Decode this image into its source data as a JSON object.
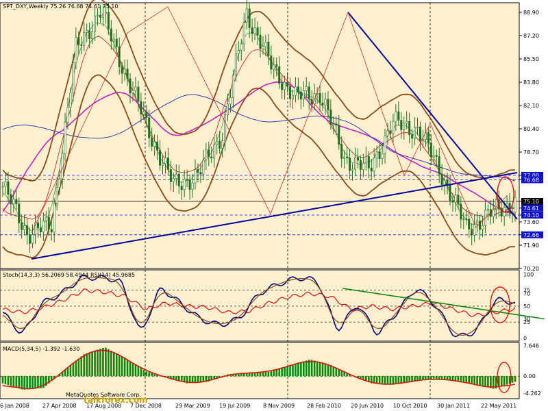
{
  "colors": {
    "background": "#fff0cf",
    "price_line": "#1f6e1f",
    "trend_line": "#0000a0",
    "ma_brown": "#8b4a12",
    "ma_magenta": "#c81ec8",
    "ma_blue": "#2e3ab0",
    "red": "#e01010",
    "green_hist": "#008a00",
    "circle": "#ff0000"
  },
  "main": {
    "header": "SPT_DXY,Weekly  75.26 76.68 74.61 75.10",
    "axis_labels": [
      "88.90",
      "87.20",
      "85.50",
      "83.80",
      "82.10",
      "80.40",
      "78.70",
      "77.00",
      "76.68",
      "75.10",
      "74.61",
      "74.10",
      "73.60",
      "72.66",
      "71.90",
      "70.20"
    ],
    "highlight_labels": [
      "77.00",
      "76.68",
      "75.10",
      "74.61",
      "74.10",
      "72.66"
    ]
  },
  "stoch": {
    "header": "Stoch(14,3,3) 56.2069 58.4944 RSI(14) 45.9685",
    "axis_labels": [
      "100",
      "75",
      "70",
      "50",
      "30",
      "25",
      "0"
    ]
  },
  "macd": {
    "header": "MACD(5,34,5) -1.392 -1.630",
    "axis_labels": [
      "7.646",
      "0.00",
      "-4.262"
    ],
    "watermark": "MetaQuotes Software Corp.",
    "brand": "talkforex.com"
  },
  "x_labels": [
    "6 Jan 2008",
    "27 Apr 2008",
    "17 Aug 2008",
    "7 Dec 2008",
    "29 Mar 2009",
    "19 Jul 2009",
    "8 Nov 2009",
    "28 Feb 2010",
    "20 Jun 2010",
    "10 Oct 2010",
    "30 Jan 2011",
    "22 May 2011"
  ],
  "chart_data": [
    {
      "type": "line",
      "title": "SPT_DXY,Weekly",
      "x": [
        "6 Jan 2008",
        "27 Apr 2008",
        "17 Aug 2008",
        "7 Dec 2008",
        "29 Mar 2009",
        "19 Jul 2009",
        "8 Nov 2009",
        "28 Feb 2010",
        "20 Jun 2010",
        "10 Oct 2010",
        "30 Jan 2011",
        "22 May 2011"
      ],
      "series": [
        {
          "values": [
            76.2,
            72.8,
            73.3,
            86.2,
            89.0,
            84.6,
            80.2,
            76.3,
            77.0,
            80.1,
            88.9,
            85.0,
            82.7,
            83.0,
            78.3,
            77.4,
            80.8,
            80.4,
            77.1,
            73.1,
            74.2,
            75.1
          ]
        }
      ],
      "ylim": [
        70.2,
        89.6
      ],
      "ohlc_last": {
        "open": 75.26,
        "high": 76.68,
        "low": 74.61,
        "close": 75.1
      }
    },
    {
      "type": "line",
      "title": "Stoch(14,3,3) RSI(14)",
      "series": [
        {
          "name": "Stoch",
          "values": [
            40,
            5,
            55,
            70,
            95,
            95,
            90,
            5,
            80,
            55,
            30,
            20,
            30,
            70,
            85,
            95,
            90,
            10,
            55,
            5,
            40,
            80,
            50,
            0,
            10,
            60,
            56
          ]
        },
        {
          "name": "RSI",
          "values": [
            45,
            40,
            48,
            60,
            75,
            72,
            65,
            45,
            55,
            50,
            48,
            40,
            42,
            55,
            65,
            70,
            65,
            45,
            50,
            45,
            50,
            55,
            45,
            35,
            40,
            46
          ]
        }
      ],
      "ylim": [
        0,
        100
      ],
      "levels": [
        75,
        70,
        50,
        30,
        25
      ]
    },
    {
      "type": "bar",
      "title": "MACD(5,34,5)",
      "values_summary": {
        "macd": -1.392,
        "signal": -1.63
      },
      "series": [
        {
          "name": "MACD",
          "values": [
            -1.8,
            -3.4,
            -2.9,
            1.5,
            5.6,
            7.2,
            4.4,
            1.2,
            -0.3,
            -1.8,
            -1.4,
            0.5,
            0.8,
            1.1,
            2.6,
            4.2,
            2.8,
            0.2,
            -1.8,
            -2.2,
            -1.2,
            -0.6,
            -1.0,
            -2.0,
            -3.2,
            -1.4
          ]
        }
      ],
      "ylim": [
        -4.262,
        7.646
      ]
    }
  ]
}
